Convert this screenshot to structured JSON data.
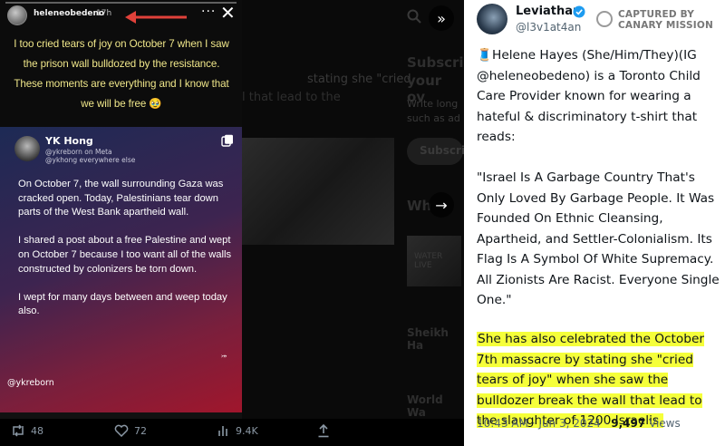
{
  "story": {
    "username": "heleneobedeno",
    "time": "17h",
    "menu": "···",
    "close": "✕",
    "quote": "I too cried tears of joy on October 7 when I saw the prison wall bulldozed by the resistance. These moments are everything and I know that we will be free 🥹"
  },
  "card": {
    "name": "YK Hong",
    "handle_line1": "@ykreborn on Meta",
    "handle_line2": "@ykhong everywhere else",
    "paragraphs": [
      "On October 7, the wall surrounding Gaza was cracked open. Today, Palestinians tear down parts of the West Bank apartheid wall.",
      "I shared a post about a free Palestine and wept on October 7 because I too want all of the walls constructed by colonizers be torn down.",
      "I wept for many days between and weep today also."
    ],
    "mark": "⤖",
    "tag": "@ykreborn"
  },
  "actions": {
    "retweets": "48",
    "likes": "72",
    "views": "9.4K"
  },
  "background": {
    "line1": "Subscri",
    "line2": "your ov",
    "line3": "Write long",
    "line4": "such as ad",
    "btn": "Subscri",
    "heading": "Wh",
    "snippet1": "stating she \"cried",
    "snippet2": "l that lead to the",
    "item1": "Sheikh Ha",
    "item2": "World Wa",
    "thumb_text": "WATER LIVE"
  },
  "tweet": {
    "name": "Leviathan",
    "handle": "@l3v1at4an",
    "badge_line1": "CAPTURED BY",
    "badge_line2": "CANARY MISSION",
    "para1": "🧵Helene Hayes (She/Him/They)(IG @heleneobedeno) is a Toronto Child Care Provider known for wearing a hateful & discriminatory t-shirt that reads:",
    "para2": "\"Israel Is A Garbage Country That's Only Loved By Garbage People. It Was Founded On Ethnic Cleansing, Apartheid, and Settler-Colonialism. Its Flag Is A Symbol Of White Supremacy. All Zionists Are Racist. Everyone Single One.\"",
    "para3": "She has also celebrated the October 7th massacre by stating she \"cried tears of joy\" when she saw the bulldozer break the wall that lead to the slaughter of 1200 Israelis.",
    "time": "10:43 AM · Jun 3, 2024 · ",
    "views_count": "9,497",
    "views_label": " Views",
    "highlight_color": "#f5ff3a",
    "verified_color": "#1d9bf0"
  }
}
